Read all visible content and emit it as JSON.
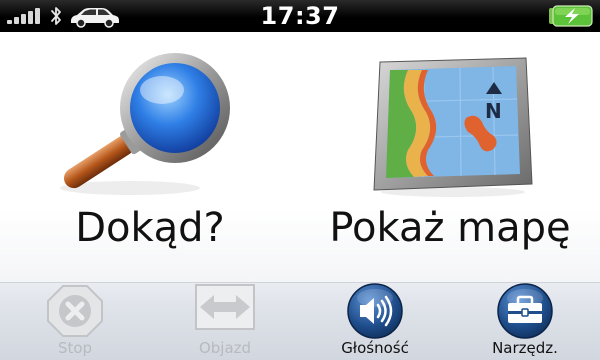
{
  "status_bar": {
    "time": "17:37",
    "icons": [
      "signal-strength-icon",
      "bluetooth-icon",
      "car-icon",
      "battery-charging-icon"
    ]
  },
  "main_menu": {
    "where_to": {
      "label": "Dokąd?",
      "icon": "magnifier-icon"
    },
    "view_map": {
      "label": "Pokaż mapę",
      "icon": "map-device-icon"
    }
  },
  "toolbar": {
    "stop": {
      "label": "Stop",
      "icon": "stop-icon",
      "enabled": false
    },
    "detour": {
      "label": "Objazd",
      "icon": "detour-arrows-icon",
      "enabled": false
    },
    "volume": {
      "label": "Głośność",
      "icon": "speaker-icon",
      "enabled": true
    },
    "tools": {
      "label": "Narzędz.",
      "icon": "toolbox-icon",
      "enabled": true
    }
  },
  "colors": {
    "status_bar": "#000000",
    "battery_green": "#5cc23a",
    "toolbar_button_blue": "#1f4e8c",
    "disabled_gray": "#b6bac0"
  }
}
